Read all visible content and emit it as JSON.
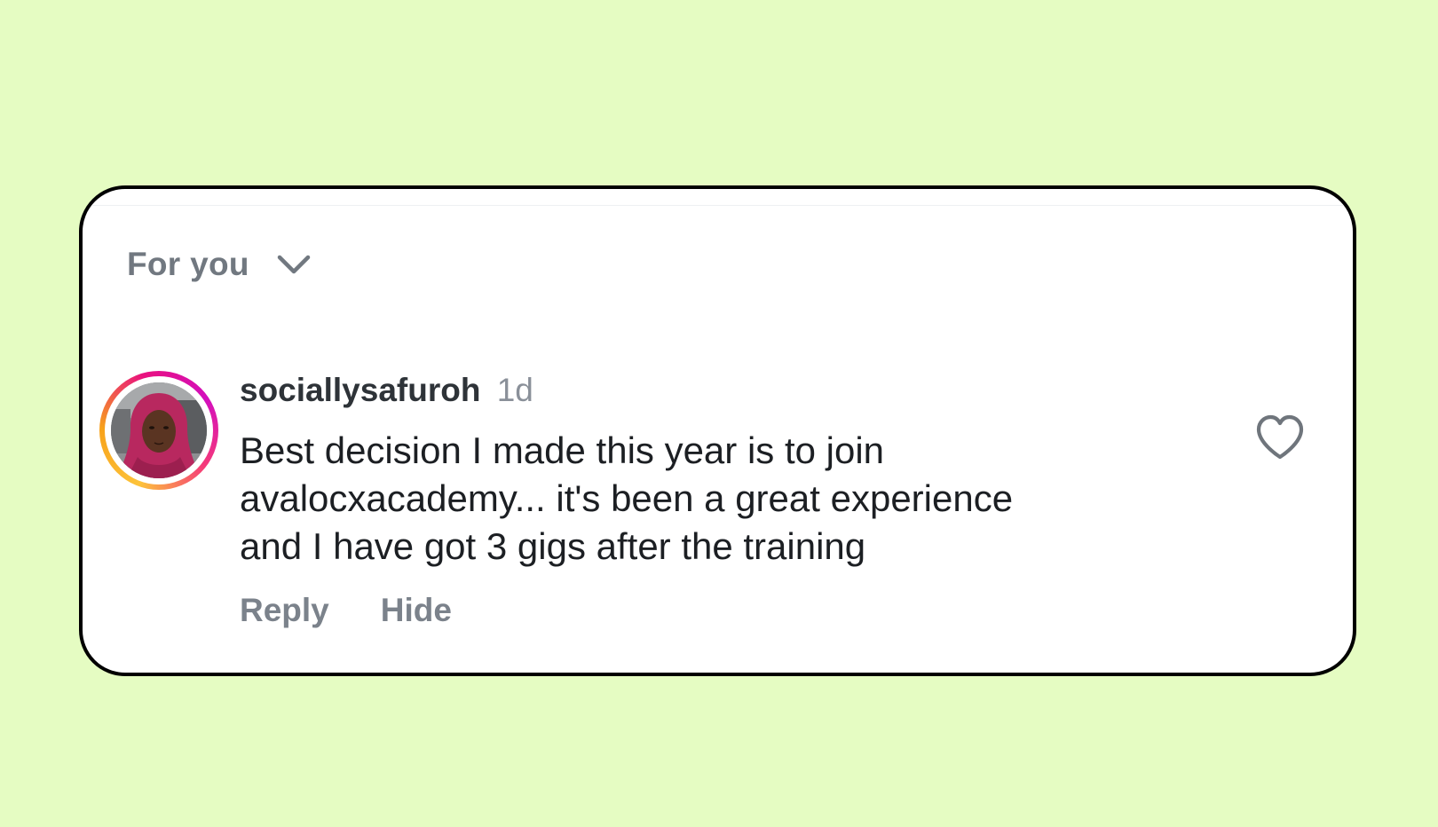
{
  "sort": {
    "label": "For you",
    "icon": "chevron-down-icon"
  },
  "comment": {
    "username": "sociallysafuroh",
    "time": "1d",
    "text_lines": [
      "Best decision I made this year is to join",
      "avalocxacademy... it's been a great experience",
      "and I have got 3 gigs after the training"
    ],
    "actions": {
      "reply": "Reply",
      "hide": "Hide"
    },
    "like_icon": "heart-outline-icon"
  },
  "colors": {
    "background": "#e5fcc2",
    "card": "#ffffff",
    "card_border": "#000000",
    "muted_text": "#717880",
    "body_text": "#1c1f23",
    "avatar_ring": [
      "#fdc33a",
      "#e9117f",
      "#d30fbd"
    ]
  }
}
